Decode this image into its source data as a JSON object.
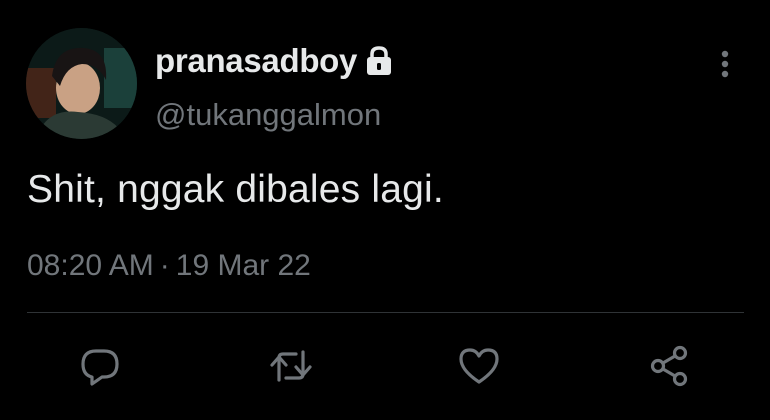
{
  "tweet": {
    "display_name": "pranasadboy",
    "handle": "@tukanggalmon",
    "text": "Shit, nggak dibales lagi.",
    "time": "08:20 AM",
    "separator": "·",
    "date": "19 Mar 22"
  },
  "icons": {
    "avatar": "profile-photo",
    "lock": "lock-icon",
    "more": "more-vertical-icon",
    "reply": "reply-icon",
    "retweet": "retweet-icon",
    "like": "heart-icon",
    "share": "share-icon"
  },
  "colors": {
    "background": "#000000",
    "primary_text": "#e7e9ea",
    "secondary_text": "#71767b",
    "divider": "#2f3336"
  }
}
